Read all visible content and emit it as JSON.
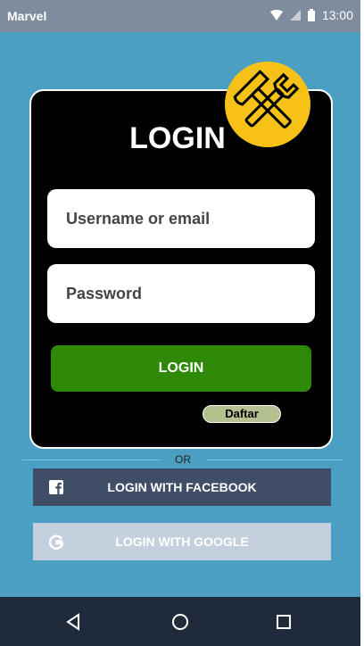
{
  "status_bar": {
    "carrier": "Marvel",
    "time": "13:00"
  },
  "login_card": {
    "title": "LOGIN",
    "username_placeholder": "Username or email",
    "password_placeholder": "Password",
    "login_button": "LOGIN",
    "register_button": "Daftar"
  },
  "divider": {
    "text": "OR"
  },
  "social": {
    "facebook_label": "LOGIN WITH FACEBOOK",
    "google_label": "LOGIN WITH GOOGLE"
  },
  "icons": {
    "badge": "hammer-wrench-icon",
    "facebook": "facebook-icon",
    "google": "google-icon",
    "nav_back": "back-icon",
    "nav_home": "home-icon",
    "nav_recents": "recents-icon"
  },
  "colors": {
    "background": "#4a9fc2",
    "card": "#000000",
    "login_button": "#2e8a06",
    "badge": "#f6c218",
    "facebook_button": "#3f4d66",
    "google_button": "#c4d0de"
  }
}
